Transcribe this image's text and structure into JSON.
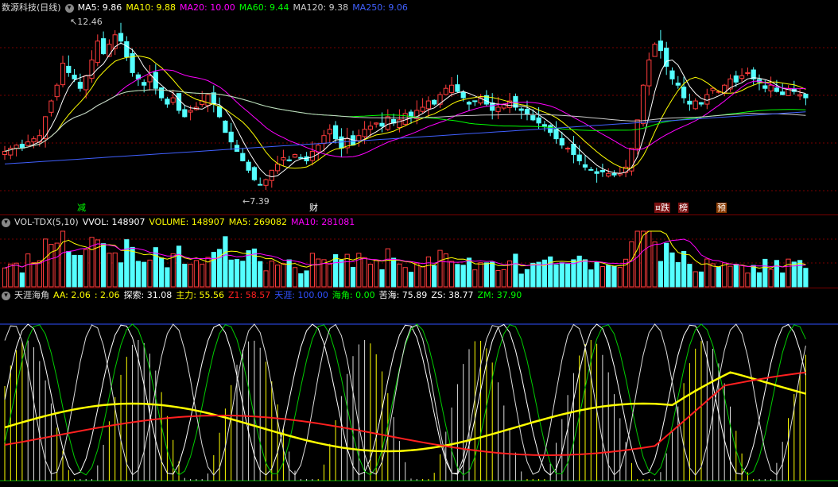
{
  "price_panel": {
    "title": "数源科技(日线)",
    "indicators": [
      {
        "label": "MA5: 9.86",
        "color": "#ffffff"
      },
      {
        "label": "MA10: 9.88",
        "color": "#ffff00"
      },
      {
        "label": "MA20: 10.00",
        "color": "#ff00ff"
      },
      {
        "label": "MA60: 9.44",
        "color": "#00ff00"
      },
      {
        "label": "MA120: 9.38",
        "color": "#cccccc"
      },
      {
        "label": "MA250: 9.06",
        "color": "#4060ff"
      }
    ],
    "high_label": "12.46",
    "low_label": "7.39",
    "markers": [
      "减",
      "财",
      "¤跌",
      "榜",
      "预"
    ]
  },
  "volume_panel": {
    "title": "VOL-TDX(5,10)",
    "indicators": [
      {
        "label": "VVOL: 148907",
        "color": "#ffffff"
      },
      {
        "label": "VOLUME: 148907",
        "color": "#ffff00"
      },
      {
        "label": "MA5: 269082",
        "color": "#ffff00"
      },
      {
        "label": "MA10: 281081",
        "color": "#ff00ff"
      }
    ]
  },
  "indicator_panel": {
    "title": "天涯海角",
    "indicators": [
      {
        "label": "AA: 2.06",
        "color": "#ffff00"
      },
      {
        "label": ": 2.06",
        "color": "#ffff00"
      },
      {
        "label": "探索: 31.08",
        "color": "#ffffff"
      },
      {
        "label": "主力: 55.56",
        "color": "#ffff00"
      },
      {
        "label": "Z1: 58.57",
        "color": "#ff2020"
      },
      {
        "label": "天涯: 100.00",
        "color": "#3050ff"
      },
      {
        "label": "海角: 0.00",
        "color": "#00ff00"
      },
      {
        "label": "苦海: 75.89",
        "color": "#ffffff"
      },
      {
        "label": "ZS: 38.77",
        "color": "#ffffff"
      },
      {
        "label": "ZM: 37.90",
        "color": "#00ff00"
      }
    ]
  },
  "colors": {
    "up": "#ff3c3c",
    "down": "#54ffff",
    "bg": "#000000",
    "grid": "#7a0000"
  },
  "chart_data": {
    "type": "candlestick",
    "closes": [
      8.5,
      8.6,
      8.7,
      8.6,
      8.8,
      8.9,
      9.0,
      9.6,
      10.1,
      10.6,
      11.3,
      11.0,
      10.8,
      10.5,
      10.9,
      11.4,
      12.0,
      11.6,
      11.9,
      12.2,
      12.0,
      11.5,
      11.0,
      10.8,
      10.6,
      10.9,
      10.5,
      10.2,
      10.0,
      10.2,
      9.8,
      9.6,
      9.8,
      9.9,
      10.1,
      10.3,
      10.0,
      9.6,
      9.1,
      8.8,
      8.5,
      8.2,
      7.9,
      7.6,
      7.45,
      7.6,
      7.9,
      8.1,
      8.3,
      8.2,
      8.4,
      8.3,
      8.2,
      8.5,
      8.7,
      9.0,
      9.2,
      8.9,
      8.6,
      8.9,
      8.7,
      9.0,
      9.2,
      9.3,
      9.4,
      9.3,
      9.6,
      9.4,
      9.5,
      9.7,
      9.6,
      9.8,
      9.9,
      10.1,
      10.0,
      10.3,
      10.5,
      10.6,
      10.4,
      10.2,
      10.0,
      10.1,
      10.2,
      10.0,
      9.8,
      9.9,
      10.0,
      10.1,
      9.9,
      9.8,
      9.7,
      9.5,
      9.4,
      9.3,
      9.1,
      8.9,
      8.7,
      8.6,
      8.4,
      8.2,
      8.0,
      7.9,
      7.8,
      7.85,
      7.8,
      7.75,
      7.8,
      8.0,
      8.6,
      9.5,
      10.6,
      11.4,
      11.9,
      11.7,
      11.2,
      10.8,
      10.6,
      10.2,
      10.0,
      10.1,
      10.0,
      10.3,
      10.5,
      10.4,
      10.6,
      10.8,
      10.7,
      10.9,
      11.0,
      10.8,
      10.7,
      10.5,
      10.6,
      10.4,
      10.3,
      10.5,
      10.4,
      10.3,
      10.2
    ],
    "volume_scale": 1.0
  }
}
